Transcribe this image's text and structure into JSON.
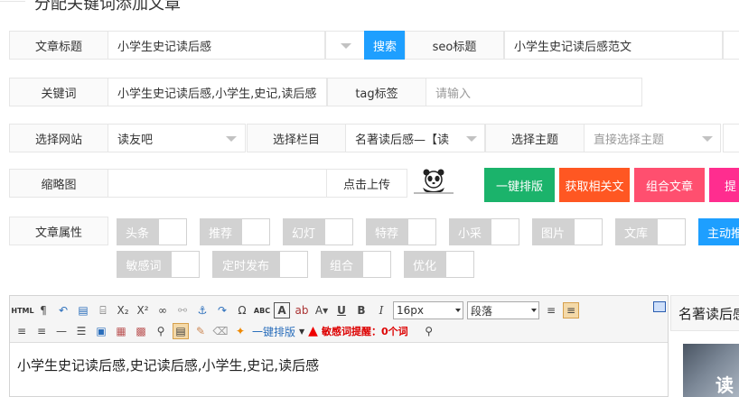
{
  "section_title": "分配关键词添加文章",
  "form": {
    "title_label": "文章标题",
    "title_value": "小学生史记读后感",
    "search_button": "搜索",
    "seo_label": "seo标题",
    "seo_value": "小学生史记读后感范文",
    "keyword_label": "关键词",
    "keyword_value": "小学生史记读后感,小学生,史记,读后感",
    "tag_label": "tag标签",
    "tag_placeholder": "请输入",
    "site_label": "选择网站",
    "site_value": "读友吧",
    "column_label": "选择栏目",
    "column_value": "名著读后感—【读",
    "theme_label": "选择主题",
    "theme_placeholder": "直接选择主题",
    "thumb_label": "缩略图",
    "upload_button": "点击上传",
    "attr_label": "文章属性"
  },
  "actions": {
    "format_button": "一键排版",
    "fetch_button": "获取相关文",
    "combine_button": "组合文章",
    "submit_button": "提",
    "push_button": "主动推"
  },
  "colors": {
    "format": "#1bb36b",
    "fetch": "#ff5722",
    "combine": "#ff4f6f",
    "submit": "#ff2d8f",
    "push": "#1e9fff",
    "search": "#1e9fff"
  },
  "attributes": [
    {
      "label": "头条",
      "checked": false
    },
    {
      "label": "推荐",
      "checked": false
    },
    {
      "label": "幻灯",
      "checked": false
    },
    {
      "label": "特荐",
      "checked": false
    },
    {
      "label": "小采",
      "checked": false
    },
    {
      "label": "图片",
      "checked": false
    },
    {
      "label": "文库",
      "checked": false
    },
    {
      "label": "敏感词",
      "checked": false
    },
    {
      "label": "定时发布",
      "checked": false
    },
    {
      "label": "组合",
      "checked": false
    },
    {
      "label": "优化",
      "checked": false
    }
  ],
  "editor": {
    "html_label": "HTML",
    "font_size": "16px",
    "paragraph": "段落",
    "format_link": "一键排版",
    "sensitive_alert": "敏感词提醒：0个词",
    "content": "小学生史记读后感,史记读后感,小学生,史记,读后感"
  },
  "sidebar": {
    "heading": "名著读后感",
    "image_text": "读"
  }
}
